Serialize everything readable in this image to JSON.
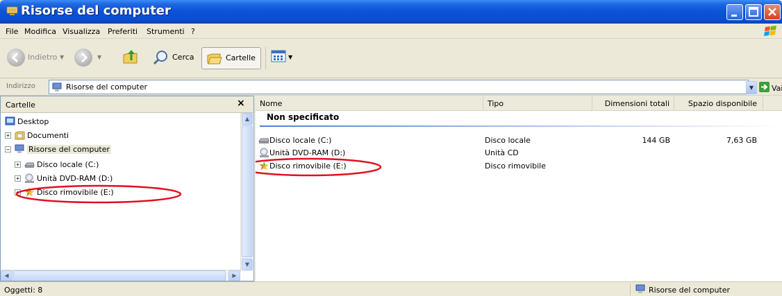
{
  "window": {
    "title": "Risorse del computer"
  },
  "menu": [
    "File",
    "Modifica",
    "Visualizza",
    "Preferiti",
    "Strumenti",
    "?"
  ],
  "toolbar": {
    "back_label": "Indietro",
    "search_label": "Cerca",
    "folders_label": "Cartelle"
  },
  "address": {
    "label": "Indirizzo",
    "value": "Risorse del computer",
    "go_label": "Vai"
  },
  "folders": {
    "title": "Cartelle",
    "close": "×",
    "tree": [
      {
        "label": "Desktop",
        "icon": "desktop-icon"
      },
      {
        "label": "Documenti",
        "icon": "documents-folder-icon"
      },
      {
        "label": "Risorse del computer",
        "icon": "my-computer-icon"
      },
      {
        "label": "Disco locale (C:)",
        "icon": "hard-disk-icon"
      },
      {
        "label": "Unità DVD-RAM (D:)",
        "icon": "dvd-drive-icon"
      },
      {
        "label": "Disco rimovibile (E:)",
        "icon": "removable-disk-icon"
      }
    ]
  },
  "files": {
    "columns": [
      "Nome",
      "Tipo",
      "Dimensioni totali",
      "Spazio disponibile"
    ],
    "group": "Non specificato",
    "rows": [
      {
        "name": "Disco locale (C:)",
        "type": "Disco locale",
        "size": "144 GB",
        "free": "7,63 GB",
        "icon": "hard-disk-icon"
      },
      {
        "name": "Unità DVD-RAM (D:)",
        "type": "Unità CD",
        "size": "",
        "free": "",
        "icon": "dvd-drive-icon"
      },
      {
        "name": "Disco rimovibile (E:)",
        "type": "Disco rimovibile",
        "size": "",
        "free": "",
        "icon": "removable-disk-icon"
      }
    ]
  },
  "status": {
    "left": "Oggetti: 8",
    "right": "Risorse del computer"
  },
  "colors": {
    "titlebar": "#0a52d8",
    "annotation": "#e0101e"
  }
}
